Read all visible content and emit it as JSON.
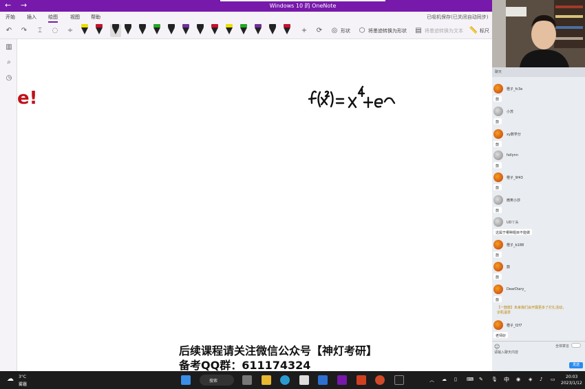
{
  "window": {
    "title": "Windows 10 的 OneNote",
    "back_icon": "←",
    "forward_icon": "→"
  },
  "ribbon": {
    "tabs": [
      "开始",
      "插入",
      "绘图",
      "视图",
      "帮助"
    ],
    "active_tab": "绘图",
    "status": "已吸机保存(已关闭自动同步)",
    "toolbar": {
      "shapes_label": "形状",
      "ink_to_shape_label": "将墨迹转换为形状",
      "ink_to_text_label": "将墨迹转换为文本",
      "ruler_label": "标尺"
    },
    "pens": [
      {
        "color": "#e8e000"
      },
      {
        "color": "#c8102e"
      },
      {
        "color": "#222222"
      },
      {
        "color": "#222222"
      },
      {
        "color": "#222222"
      },
      {
        "color": "#22aa22"
      },
      {
        "color": "#222222"
      },
      {
        "color": "#7030a0"
      },
      {
        "color": "#222222"
      },
      {
        "color": "#c8102e"
      },
      {
        "color": "#e8e000"
      },
      {
        "color": "#22aa22"
      },
      {
        "color": "#7030a0"
      },
      {
        "color": "#222222"
      },
      {
        "color": "#c8102e"
      }
    ]
  },
  "canvas": {
    "red_fragment": "e!",
    "ink_formula": "f(x²)=x⁴+e^",
    "watermark_line1": "后续课程请关注微信公众号【神灯考研】",
    "watermark_line2": "备考QQ群：611174324"
  },
  "chat": {
    "header": "聊天",
    "messages": [
      {
        "user": "橙子_fc3e",
        "text": "鼓"
      },
      {
        "user": "小苏",
        "text": "鼓"
      },
      {
        "user": "xy数学分",
        "text": "鼓"
      },
      {
        "user": "fallynn",
        "text": "鼓"
      },
      {
        "user": "橙子_9f43",
        "text": "鼓"
      },
      {
        "user": "微笑小莎",
        "text": "鼓"
      },
      {
        "user": "UD丫头",
        "text": "这属于哪种题目不能做"
      },
      {
        "user": "橙子_b188",
        "text": "鼓"
      },
      {
        "user": "鼓",
        "text": "鼓"
      },
      {
        "user": "DearDiary_",
        "text": "鼓"
      },
      {
        "user": "橙子_f2f7",
        "text": "老师好"
      }
    ],
    "notice": "【一鼓鼓】未来我们会开展更多了打扎活动，识机温享",
    "mute_all": "全体禁言",
    "input_placeholder": "请输入聊天内容",
    "send_label": "发送"
  },
  "taskbar": {
    "weather_temp": "3°C",
    "weather_desc": "雾霾",
    "search_label": "搜索",
    "ime": "中",
    "time": "20:03",
    "date": "2023/1/12"
  }
}
